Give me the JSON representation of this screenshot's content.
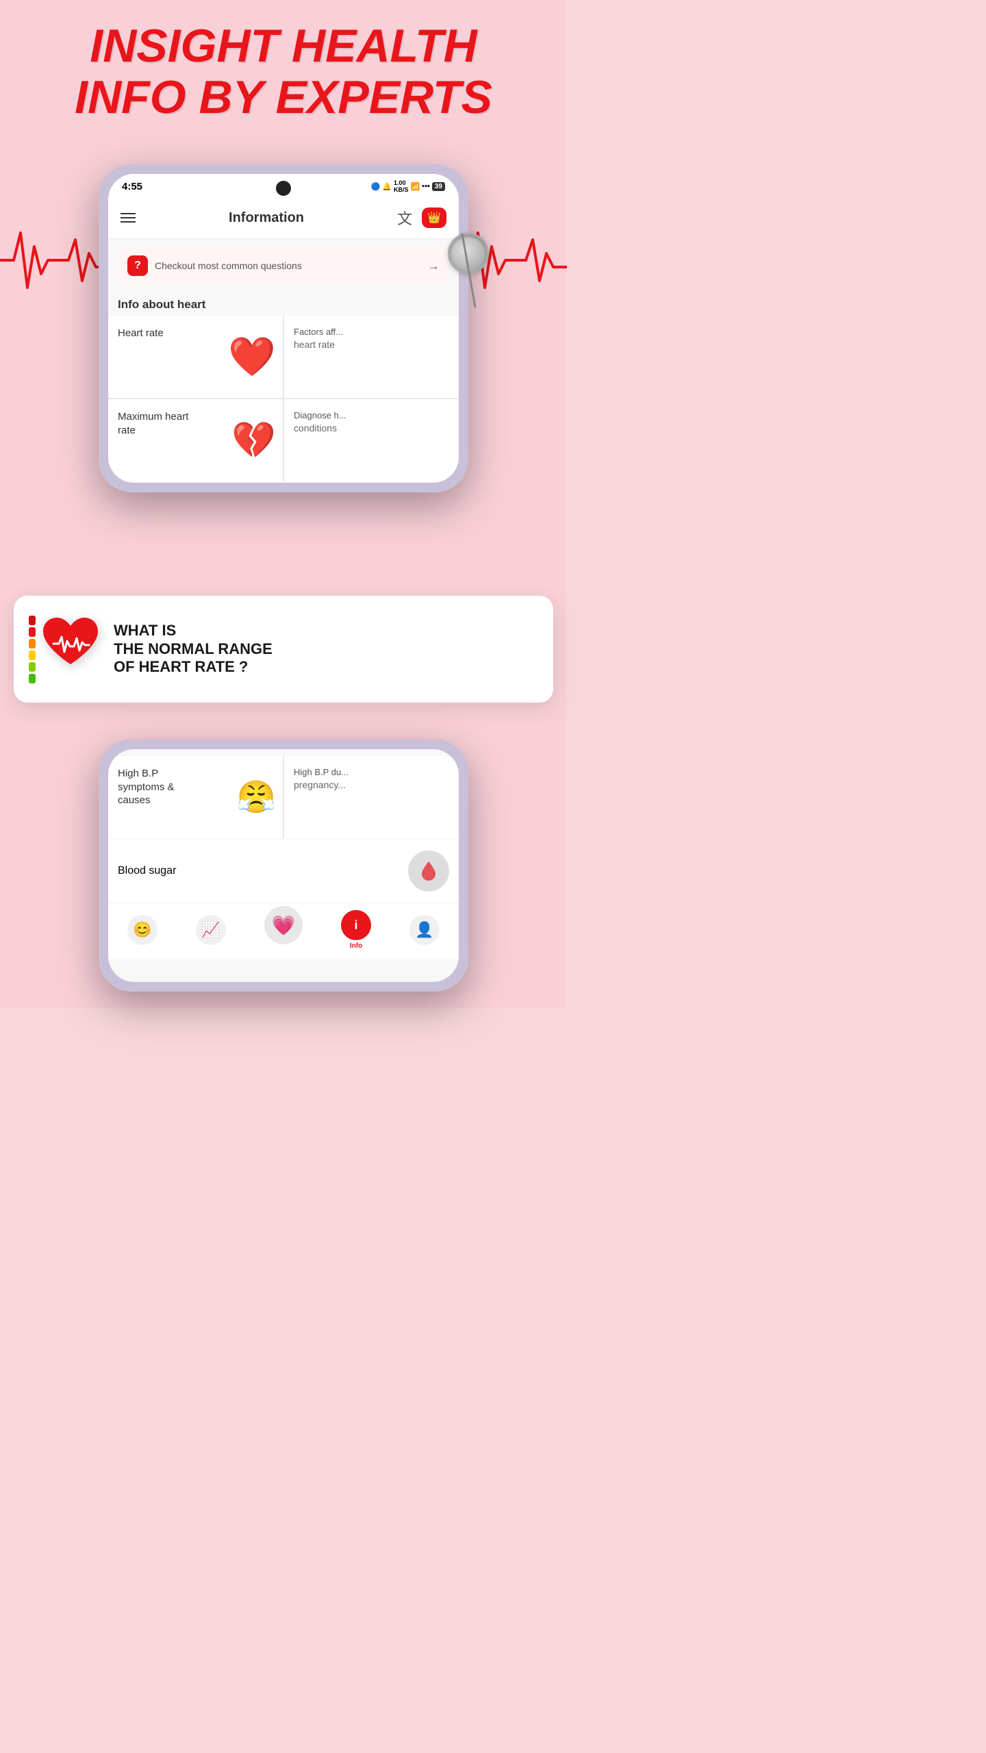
{
  "title": {
    "line1": "INSIGHT HEALTH",
    "line2": "INFO BY EXPERTS"
  },
  "phone": {
    "status_bar": {
      "time": "4:55",
      "icons": "🔵 🔔 1.00 KB/S 📶 ⬆⬇ 39"
    },
    "header": {
      "title": "Information",
      "translate_label": "translate",
      "crown_label": "crown"
    },
    "faq_banner": {
      "icon": "?",
      "text": "Checkout most common questions",
      "arrow": "→"
    },
    "section_label": "Info about heart",
    "cards": [
      {
        "label": "Heart rate",
        "emoji": "❤️",
        "partial": false
      },
      {
        "label": "Factors aff...\nheart rate",
        "emoji": null,
        "partial": true
      },
      {
        "label": "Maximum heart rate",
        "emoji": "💔",
        "partial": false
      },
      {
        "label": "Diagnose h...\nconditions",
        "emoji": null,
        "partial": true
      }
    ],
    "bottom_cards": [
      {
        "label": "High B.P symptoms & causes",
        "emoji": "😤",
        "partial": false
      },
      {
        "label": "High B.P du...\npregnancy...",
        "emoji": null,
        "partial": true
      }
    ],
    "blood_sugar_label": "Blood sugar"
  },
  "overlay_card": {
    "title_line1": "WHAT IS",
    "title_line2": "THE NORMAL RANGE",
    "title_line3": "OF HEART RATE ?"
  },
  "bottom_nav": {
    "items": [
      {
        "icon": "😊",
        "label": "",
        "active": false,
        "name": "home"
      },
      {
        "icon": "📈",
        "label": "",
        "active": false,
        "name": "stats"
      },
      {
        "icon": "💗",
        "label": "",
        "active": false,
        "name": "heart-center"
      },
      {
        "icon": "i",
        "label": "Info",
        "active": true,
        "name": "info"
      },
      {
        "icon": "👤",
        "label": "",
        "active": false,
        "name": "profile"
      }
    ]
  },
  "gauge_colors": [
    "#e8151a",
    "#e8151a",
    "#ff8800",
    "#ffcc00",
    "#88cc00",
    "#44bb00"
  ],
  "accent_color": "#e8151a"
}
